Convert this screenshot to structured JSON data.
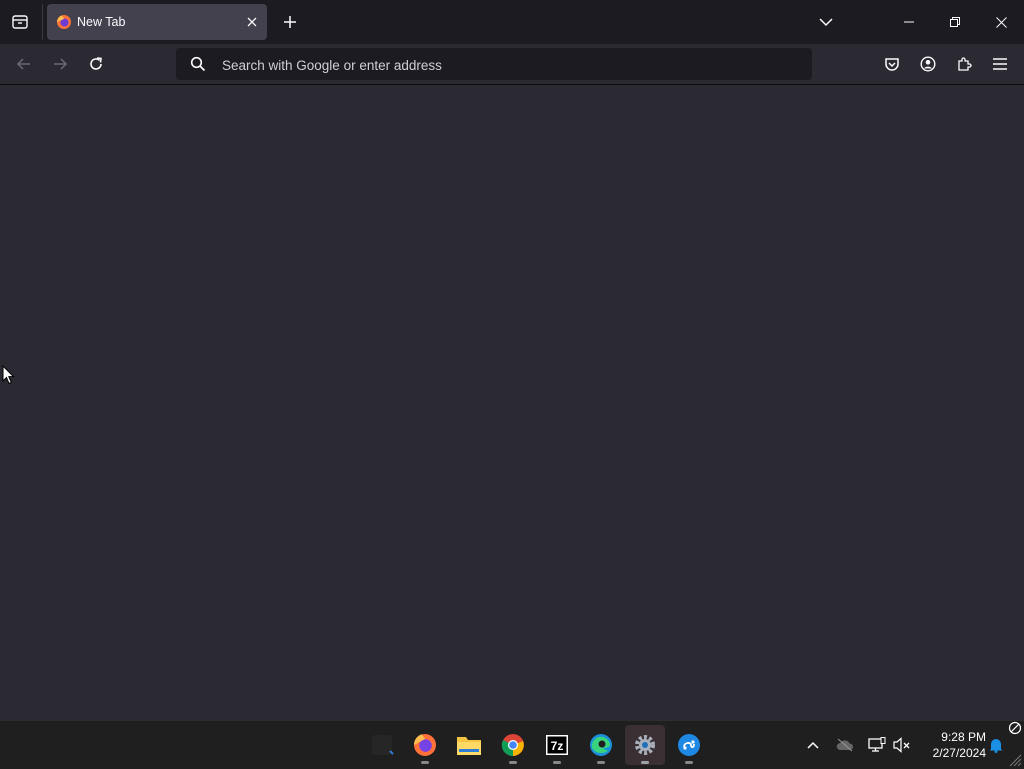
{
  "tab": {
    "title": "New Tab"
  },
  "urlbar": {
    "placeholder": "Search with Google or enter address",
    "value": ""
  },
  "clock": {
    "time": "9:28 PM",
    "date": "2/27/2024"
  },
  "taskbar": {
    "apps": [
      "blank-app",
      "firefox",
      "file-explorer",
      "chrome",
      "7-zip",
      "edge",
      "settings",
      "remote-app"
    ]
  },
  "colors": {
    "chrome_bg": "#1c1b22",
    "toolbar_bg": "#2b2a33",
    "tab_active": "#42414d",
    "taskbar_bg": "#1f1f1f"
  }
}
